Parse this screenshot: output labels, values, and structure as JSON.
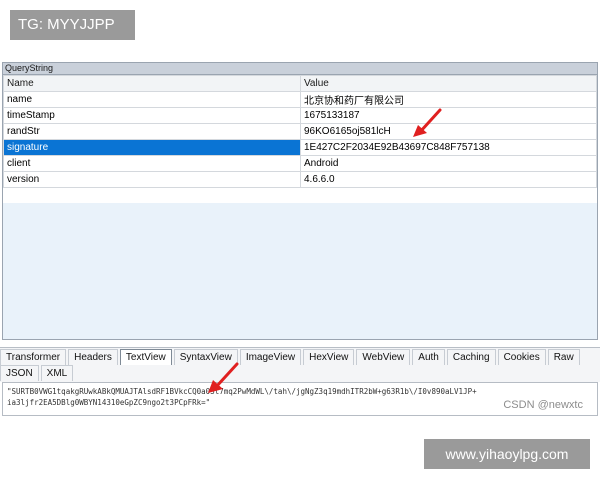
{
  "overlay": {
    "tg_label": "TG: MYYJJPP",
    "url_label": "www.yihaoylpg.com"
  },
  "querystring": {
    "title": "QueryString",
    "columns": [
      "Name",
      "Value"
    ],
    "rows": [
      {
        "name": "name",
        "value": "北京协和药厂有限公司"
      },
      {
        "name": "timeStamp",
        "value": "1675133187"
      },
      {
        "name": "randStr",
        "value": "96KO6165oj581lcH"
      },
      {
        "name": "signature",
        "value": "1E427C2F2034E92B43697C848F757138"
      },
      {
        "name": "client",
        "value": "Android"
      },
      {
        "name": "version",
        "value": "4.6.6.0"
      }
    ],
    "selected_row": "signature"
  },
  "tabs": {
    "row1": [
      "Transformer",
      "Headers",
      "TextView",
      "SyntaxView",
      "ImageView",
      "HexView",
      "WebView",
      "Auth",
      "Caching",
      "Cookies",
      "Raw"
    ],
    "row2": [
      "JSON",
      "XML"
    ],
    "active": "TextView"
  },
  "textview": {
    "line1": "\"SURTB0VWG1tqakgRUwkABkQMUAJTAlsdRF1BVkcCQ0a05t7mq2PwMdWL\\/tah\\/jgNgZ3q19mdhITR2bW+g63R1b\\/I0v890aLV1JP+",
    "line2": "ia3ljfr2EA5DBlg0WBYN14310eGpZC9ngo2t3PCpFRk=\"",
    "watermark": "CSDN @newxtc"
  },
  "colors": {
    "selection": "#0a74d4",
    "arrow": "#e02020",
    "badge": "#9a9a9a"
  }
}
